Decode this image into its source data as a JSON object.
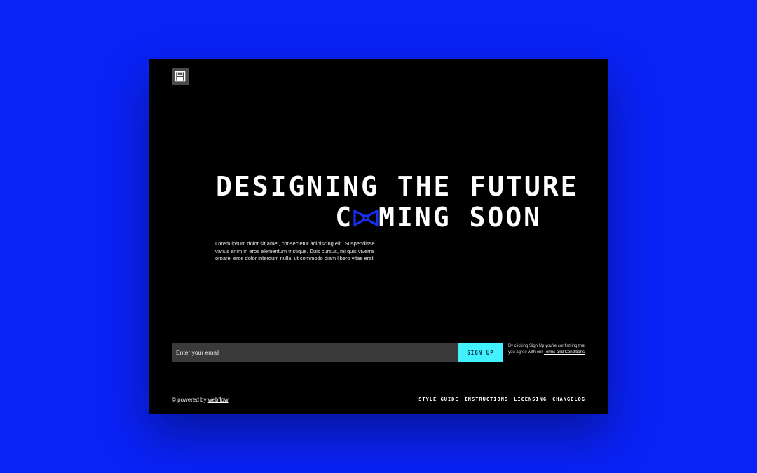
{
  "page": {
    "background_color": "#0a22f5",
    "card_color": "#000000"
  },
  "logo": {
    "icon": "floppy-disk-icon"
  },
  "hero": {
    "line1": "DESIGNING THE FUTURE",
    "line2_first_letter": "C",
    "line2_accent_letter": "O",
    "line2_rest": "MING SOON",
    "accent_icon": "pixel-bow-icon",
    "accent_color": "#1630f2",
    "description": "Lorem ipsum dolor sit amet, consectetur adipiscing elit. Suspendisse varius enim in eros elementum tristique. Duis cursus, mi quis viverra ornare, eros dolor interdum nulla, ut commodo diam libero vitae erat."
  },
  "signup": {
    "email_placeholder": "Enter your email",
    "button_label": "SIGN UP",
    "button_color": "#41f1ff",
    "legal_text": "By clicking Sign Up you're confirming that you agree with our ",
    "terms_link": "Terms and Conditions",
    "legal_suffix": "."
  },
  "footer": {
    "copyright_symbol": "©",
    "powered_text": " powered by ",
    "powered_link": "webflow",
    "nav": [
      {
        "label": "STYLE GUIDE"
      },
      {
        "label": "INSTRUCTIONS"
      },
      {
        "label": "LICENSING"
      },
      {
        "label": "CHANGELOG"
      }
    ]
  }
}
